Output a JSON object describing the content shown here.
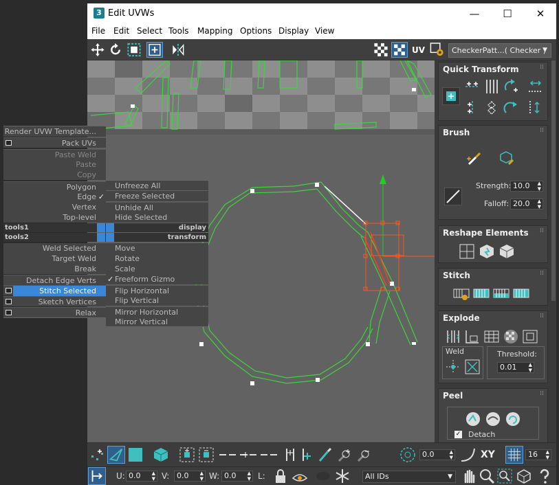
{
  "window": {
    "title": "Edit UVWs",
    "logo": "3",
    "minimize": "—",
    "maximize": "☐",
    "close": "✕"
  },
  "menubar": [
    "File",
    "Edit",
    "Select",
    "Tools",
    "Mapping",
    "Options",
    "Display",
    "View"
  ],
  "toolbar": {
    "uv_label": "UV",
    "checker_dropdown": "CheckerPatt...( Checker )"
  },
  "panel": {
    "quick_transform": "Quick Transform",
    "brush": "Brush",
    "strength_label": "Strength:",
    "strength_value": "10.0",
    "falloff_label": "Falloff:",
    "falloff_value": "20.0",
    "reshape": "Reshape Elements",
    "stitch": "Stitch",
    "explode": "Explode",
    "weld_label": "Weld",
    "threshold_label": "Threshold:",
    "threshold_value": "0.01",
    "peel": "Peel",
    "detach_label": "Detach"
  },
  "bottom": {
    "angle_value": "0.0",
    "xy_label": "XY",
    "grid_value": "16",
    "u_label": "U:",
    "u_value": "0.0",
    "v_label": "V:",
    "v_value": "0.0",
    "w_label": "W:",
    "w_value": "0.0",
    "l_label": "L:",
    "ids_dropdown": "All IDs"
  },
  "quad": {
    "left": [
      {
        "label": "Render UVW Template...",
        "type": "item"
      },
      {
        "label": "Pack UVs",
        "type": "item",
        "box": true
      },
      {
        "label": "Paste Weld",
        "type": "disabled"
      },
      {
        "label": "Paste",
        "type": "disabled"
      },
      {
        "label": "Copy",
        "type": "disabled"
      },
      {
        "label": "Polygon",
        "type": "item"
      },
      {
        "label": "Edge",
        "type": "item",
        "check": true
      },
      {
        "label": "Vertex",
        "type": "item"
      },
      {
        "label": "Top-level",
        "type": "item"
      },
      {
        "label": "Weld Selected",
        "type": "item"
      },
      {
        "label": "Target Weld",
        "type": "item"
      },
      {
        "label": "Break",
        "type": "item"
      },
      {
        "label": "Detach Edge Verts",
        "type": "item"
      },
      {
        "label": "Stitch Selected",
        "type": "selected",
        "box": true
      },
      {
        "label": "Sketch Vertices",
        "type": "item",
        "box": true
      },
      {
        "label": "Relax",
        "type": "item",
        "box": true
      }
    ],
    "right": [
      {
        "label": "Unfreeze All",
        "type": "item"
      },
      {
        "label": "Freeze Selected",
        "type": "item"
      },
      {
        "label": "Unhide All",
        "type": "item"
      },
      {
        "label": "Hide Selected",
        "type": "item"
      },
      {
        "label": "Move",
        "type": "item"
      },
      {
        "label": "Rotate",
        "type": "item"
      },
      {
        "label": "Scale",
        "type": "item"
      },
      {
        "label": "Freeform Gizmo",
        "type": "item",
        "check": true
      },
      {
        "label": "Flip Horizontal",
        "type": "item"
      },
      {
        "label": "Flip Vertical",
        "type": "item"
      },
      {
        "label": "Mirror Horizontal",
        "type": "item"
      },
      {
        "label": "Mirror Vertical",
        "type": "item"
      }
    ],
    "tools1": "tools1",
    "tools2": "tools2",
    "display": "display",
    "transform": "transform",
    "check_mark": "✓"
  },
  "colors": {
    "uv_edge": "#3bd63b",
    "selected_edge": "#ff3b1f",
    "gizmo_y": "#22cc22",
    "gizmo_x": "#ff5522",
    "quad_highlight": "#3a86d9",
    "icon_teal": "#3fbfbf"
  }
}
